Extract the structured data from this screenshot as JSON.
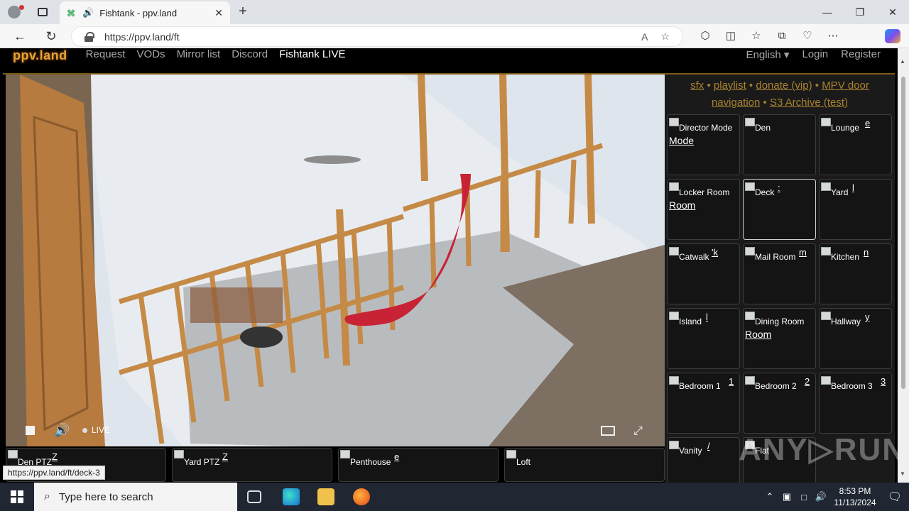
{
  "browser": {
    "tab_title": "Fishtank - ppv.land",
    "url": "https://ppv.land/ft",
    "read_aloud": "A",
    "status_url": "https://ppv.land/ft/deck-3"
  },
  "site": {
    "logo": "ppv.land",
    "nav": [
      "Request",
      "VODs",
      "Mirror list",
      "Discord",
      "Fishtank LIVE"
    ],
    "language": "English ▾",
    "login": "Login",
    "register": "Register"
  },
  "panel": {
    "link_sfx": "sfx",
    "link_playlist": "playlist",
    "link_donate": "donate (vip)",
    "link_mpv": "MPV door",
    "link_navigation": "navigation",
    "link_s3": "S3 Archive (test)",
    "sep": "•",
    "cams": [
      {
        "name": "Director Mode",
        "sub": "Mode",
        "tail": ""
      },
      {
        "name": "Den",
        "sub": "",
        "tail": ""
      },
      {
        "name": "Lounge",
        "sub": "",
        "tail": "e"
      },
      {
        "name": "Locker Room",
        "sub": "Room",
        "tail": ""
      },
      {
        "name": "Deck",
        "sub": "",
        "tail": ":"
      },
      {
        "name": "Yard",
        "sub": "",
        "tail": "l"
      },
      {
        "name": "Catwalk",
        "sub": "",
        "tail": "'k"
      },
      {
        "name": "Mail Room",
        "sub": "",
        "tail": "m"
      },
      {
        "name": "Kitchen",
        "sub": "",
        "tail": "n"
      },
      {
        "name": "Island",
        "sub": "",
        "tail": "l"
      },
      {
        "name": "Dining Room",
        "sub": "Room",
        "tail": ""
      },
      {
        "name": "Hallway",
        "sub": "",
        "tail": "y"
      },
      {
        "name": "Bedroom 1",
        "sub": "",
        "tail": "1"
      },
      {
        "name": "Bedroom 2",
        "sub": "",
        "tail": "2"
      },
      {
        "name": "Bedroom 3",
        "sub": "",
        "tail": "3"
      },
      {
        "name": "Vanity",
        "sub": "",
        "tail": "/"
      },
      {
        "name": "Flat",
        "sub": "",
        "tail": ""
      }
    ]
  },
  "strip": [
    {
      "name": "Den PTZ",
      "tail": "Z"
    },
    {
      "name": "Yard PTZ",
      "tail": "Z"
    },
    {
      "name": "Penthouse",
      "tail": "e"
    },
    {
      "name": "Loft",
      "tail": ""
    }
  ],
  "player": {
    "live_label": "LIVE"
  },
  "watermark": "ANY▷RUN",
  "taskbar": {
    "search_placeholder": "Type here to search",
    "time": "8:53 PM",
    "date": "11/13/2024"
  }
}
